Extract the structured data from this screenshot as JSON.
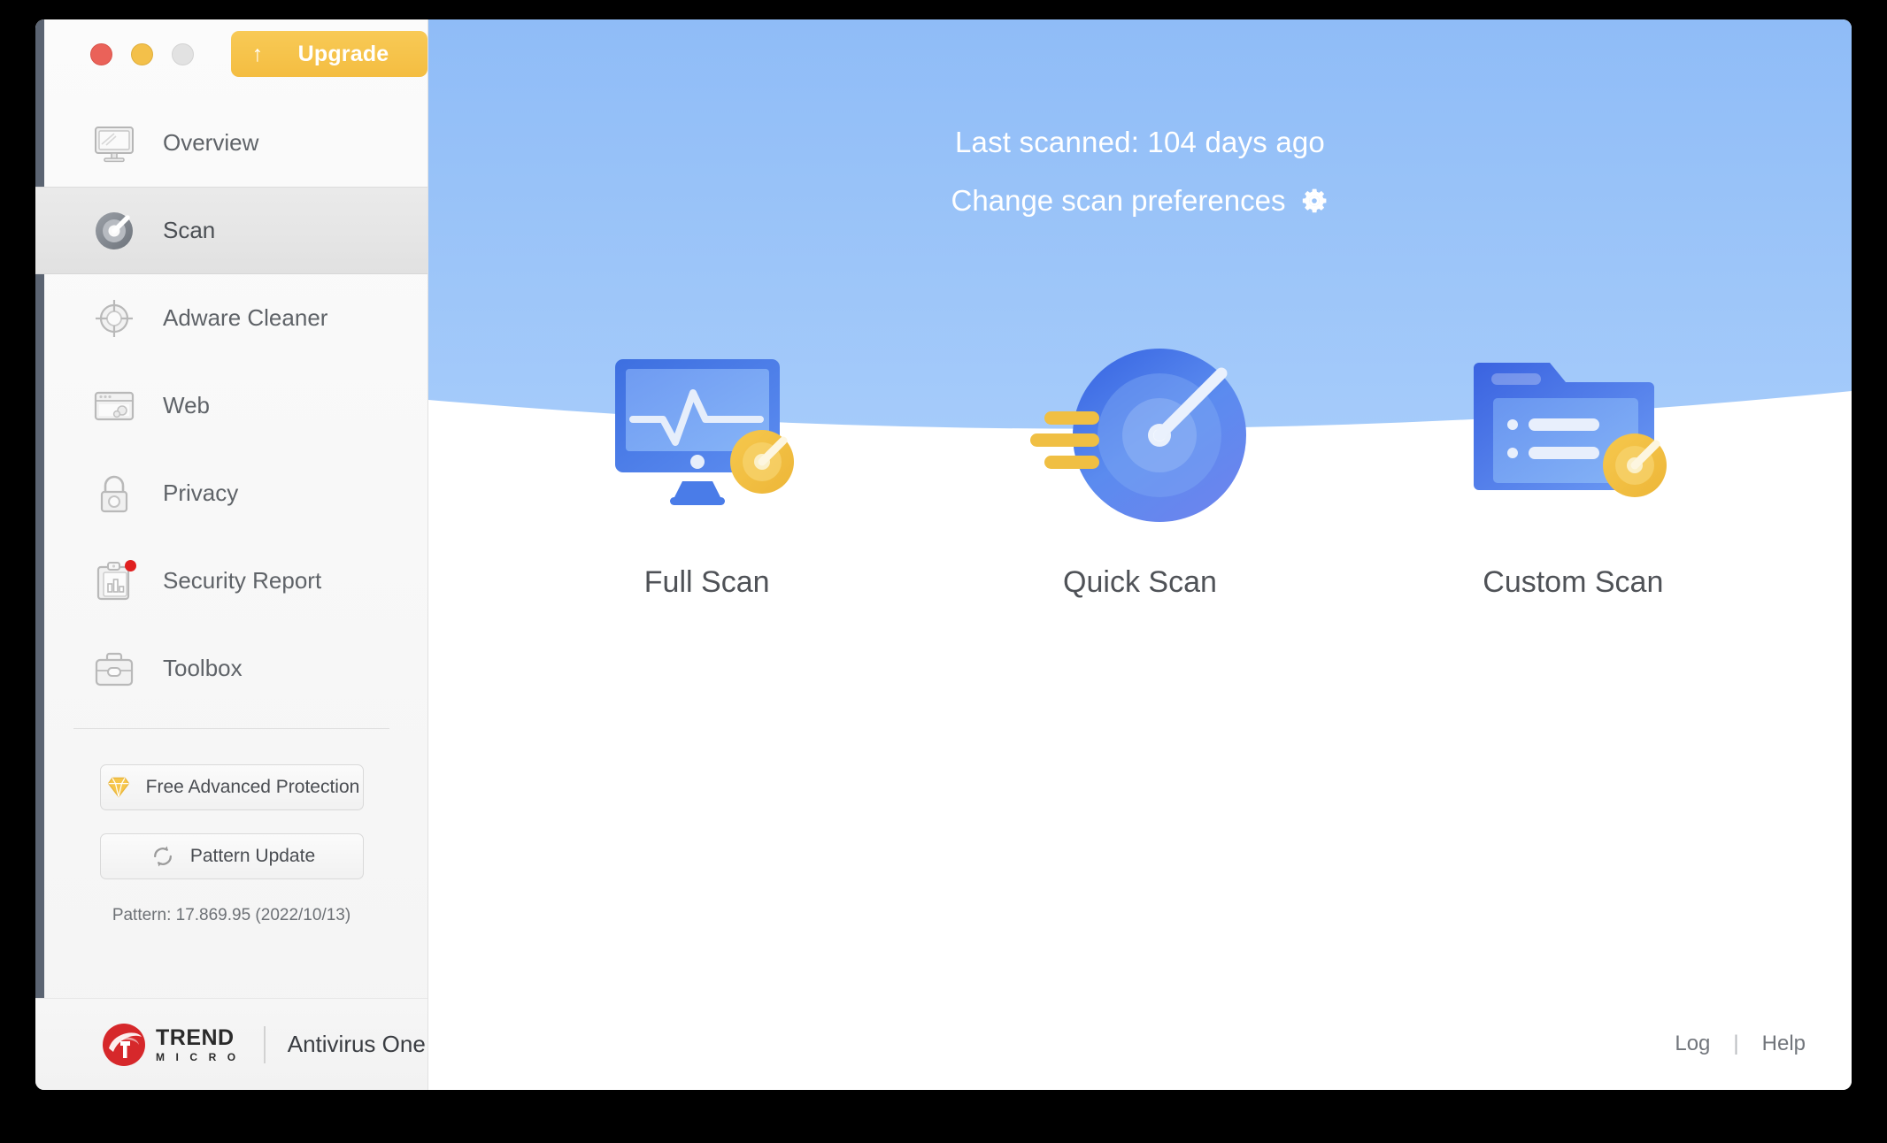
{
  "window": {
    "traffic_lights": [
      "close",
      "minimize",
      "maximize"
    ],
    "upgrade": {
      "label": "Upgrade",
      "arrow_icon": "arrow-up-icon",
      "color": "#f4bd41"
    }
  },
  "sidebar": {
    "items": [
      {
        "id": "overview",
        "label": "Overview",
        "icon": "monitor-icon",
        "active": false,
        "badge": false
      },
      {
        "id": "scan",
        "label": "Scan",
        "icon": "radar-icon",
        "active": true,
        "badge": false
      },
      {
        "id": "adware-cleaner",
        "label": "Adware Cleaner",
        "icon": "crosshair-icon",
        "active": false,
        "badge": false
      },
      {
        "id": "web",
        "label": "Web",
        "icon": "browser-icon",
        "active": false,
        "badge": false
      },
      {
        "id": "privacy",
        "label": "Privacy",
        "icon": "lock-icon",
        "active": false,
        "badge": false
      },
      {
        "id": "security-report",
        "label": "Security Report",
        "icon": "clipboard-icon",
        "active": false,
        "badge": true
      },
      {
        "id": "toolbox",
        "label": "Toolbox",
        "icon": "briefcase-icon",
        "active": false,
        "badge": false
      }
    ],
    "free_protection": {
      "label": "Free Advanced Protection",
      "icon": "diamond-icon"
    },
    "pattern_update": {
      "label": "Pattern Update",
      "icon": "refresh-icon"
    },
    "pattern_version": "Pattern: 17.869.95 (2022/10/13)",
    "brand": {
      "name_line1": "TREND",
      "name_line2": "M I C R O",
      "product": "Antivirus One",
      "logo_icon": "trend-micro-logo-icon",
      "logo_color": "#d6282b"
    }
  },
  "main": {
    "last_scanned": "Last scanned: 104 days ago",
    "scan_preferences": {
      "label": "Change scan preferences",
      "icon": "gear-icon"
    },
    "hero_color": "#9ec4f7",
    "scan_options": [
      {
        "id": "full-scan",
        "label": "Full Scan",
        "icon": "monitor-pulse-scan-icon"
      },
      {
        "id": "quick-scan",
        "label": "Quick Scan",
        "icon": "radar-speed-icon"
      },
      {
        "id": "custom-scan",
        "label": "Custom Scan",
        "icon": "folder-list-scan-icon"
      }
    ],
    "footer": {
      "log": "Log",
      "separator": "|",
      "help": "Help"
    }
  }
}
